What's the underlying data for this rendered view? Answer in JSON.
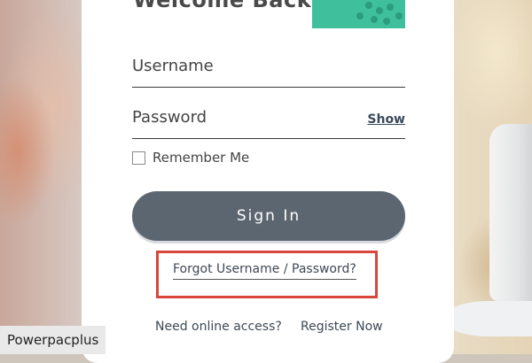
{
  "header": {
    "title": "Welcome Back!"
  },
  "form": {
    "username_label": "Username",
    "password_label": "Password",
    "show_label": "Show",
    "remember_label": "Remember Me",
    "remember_checked": false,
    "signin_label": "Sign In",
    "forgot_label": "Forgot Username / Password?"
  },
  "footer": {
    "need_access_text": "Need online access?",
    "register_label": "Register Now"
  },
  "watermark": {
    "text": "Powerpacplus"
  },
  "colors": {
    "accent_teal": "#3fbf9b",
    "button_gray": "#5c6670",
    "highlight_red": "#d9463c"
  }
}
